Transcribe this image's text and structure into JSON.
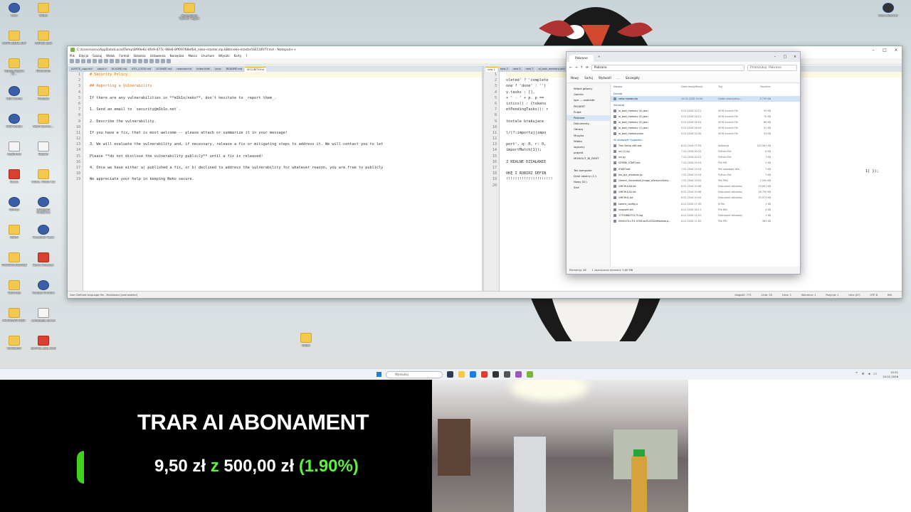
{
  "desktop": {
    "icons_left": [
      {
        "label": "Kosz",
        "kind": "app"
      },
      {
        "label": "MATH_QUIZ_APP",
        "kind": "folder"
      },
      {
        "label": "Attack Report M…",
        "kind": "folder"
      },
      {
        "label": "OBS Studio",
        "kind": "app"
      },
      {
        "label": "OBS-Studio",
        "kind": "app"
      },
      {
        "label": "Ag-BJ-tyle",
        "kind": "doc"
      },
      {
        "label": "Brave",
        "kind": "red"
      },
      {
        "label": "Obrazy",
        "kind": "app"
      },
      {
        "label": "QSUN",
        "kind": "folder"
      },
      {
        "label": "PROGRAMOWANIE",
        "kind": "folder"
      },
      {
        "label": "Edit-tryg",
        "kind": "folder"
      },
      {
        "label": "PR-PRAWO-ROZ-",
        "kind": "folder"
      },
      {
        "label": "Kalkulator",
        "kind": "folder"
      }
    ],
    "icons_col2": [
      {
        "label": "Kluby",
        "kind": "folder"
      },
      {
        "label": "MATHE_UJ-S",
        "kind": "folder"
      },
      {
        "label": "Ekonomia",
        "kind": "folder"
      },
      {
        "label": "Podcast",
        "kind": "folder"
      },
      {
        "label": "Neon-Ks-Acc…",
        "kind": "folder"
      },
      {
        "label": "Bigtwo",
        "kind": "doc"
      },
      {
        "label": "Klony, Folder (2)",
        "kind": "folder"
      },
      {
        "label": "Microsoft OneDrive",
        "kind": "app"
      },
      {
        "label": "Facebook Teaw",
        "kind": "app"
      },
      {
        "label": "Brave Browser",
        "kind": "red"
      },
      {
        "label": "Google Chrome",
        "kind": "app"
      },
      {
        "label": "Language_de-en",
        "kind": "doc"
      },
      {
        "label": "gaming_app_cloud",
        "kind": "red"
      }
    ],
    "top_icon": {
      "label": "Screenshot Upload Toggle"
    },
    "mid_folder": {
      "label": "folder"
    },
    "recycle_right": {
      "label": "Kosz aktywny"
    }
  },
  "notepad": {
    "title": "C:\\Users\\ozsu\\AppData\\Local\\Temp\\8f99e6c-4fe9-477c-98e6-8ff09768efb4_neko-master.zip.b8b\\neko-master\\SECURITY.md - Notepad++",
    "menu": [
      "Plik",
      "Edycja",
      "Szukaj",
      "Widok",
      "Format",
      "Składnia",
      "Ustawienia",
      "Narzędzia",
      "Makra",
      "Uruchom",
      "Wtyczki",
      "Karty",
      "?"
    ],
    "left_tabs": [
      "ALYSTE_copy.md",
      "stack.h",
      "ACLONE.md",
      "KTO_LOGGI.md",
      "LICENSE.md",
      "readme.md",
      "index.html",
      "ionic",
      "README.md",
      "SECURITY.md"
    ],
    "right_tabs": [
      "new 1",
      "new 3",
      "new 5",
      "new 7",
      "ai_task_memory.json"
    ],
    "left_lines": [
      "# Security Policy",
      "",
      "## Reporting a Vulnerability",
      "",
      "If there are any vulnerabilities in **m1k1o/neko**, don't hesitate to _report them_.",
      "",
      "1. Send an email to `security@m1k1o.net`.",
      "",
      "2. Describe the vulnerability.",
      "",
      "   If you have a fix, that is most welcome -- please attach or summarize it in your message!",
      "",
      "3. We will evaluate the vulnerability and, if necessary, release a fix or mitigating steps to address it. We will contact you to let",
      "",
      "   Please **do not disclose the vulnerability publicly** until a fix is released!",
      "",
      "4. Once we have either a) published a fix, or b) declined to address the vulnerability for whatever reason, you are free to publicly",
      "",
      "We appreciate your help in keeping Neko secure."
    ],
    "right_lines": [
      "",
      "oleted' ? 'complete",
      "one ? 'done' : '')",
      "y.tasks : [],",
      "+ ' - ' + p. p ==",
      "istics() : {tokens",
      "etPendingTasks(): r",
      "",
      "tostale brakujace",
      "",
      "l/(?:importuj|impo",
      "",
      "port', q: 0, r: 0,",
      "  importMatch[1]);",
      "",
      "Z REALNE DZIAŁANIE",
      "",
      "UKĘ I ROBIRZ DEFIN",
      "!!!!!!!!!!!!!!!!!!!!!",
      ""
    ],
    "right_extra": "1] });",
    "status": {
      "language": "User Defined language file - Markdown (preinstalled)",
      "length": "długość: 773",
      "lines": "Linie: 20",
      "ln": "Linia: 1",
      "col": "Kolumna: 1",
      "pos": "Pozycja: 1",
      "eol": "Unix (LF)",
      "enc": "UTF-8",
      "ins": "INS"
    }
  },
  "explorer": {
    "tab": "Pobrane",
    "path": "Pobrane",
    "search_placeholder": "Przeszukaj: Pobrane",
    "toolbar": [
      "Nowy",
      "Sortuj",
      "Wyświetl",
      "…",
      "Szczegóły"
    ],
    "nav": [
      "Widok główny",
      "Galeria",
      "Igor — osobiste",
      "PROJEKT",
      "Pulpit",
      "Pobrane",
      "Dokumenty",
      "Obrazy",
      "Muzyka",
      "Wideo",
      "logiczny",
      "projekt",
      "MONOLIT_BI_RENT",
      "",
      "Ten komputer",
      "Dysk lokalny (C:)",
      "Nowy (D:)",
      "Sieć"
    ],
    "headers": [
      "Nazwa",
      "Data modyfikacji",
      "Typ",
      "Rozmiar"
    ],
    "rows": [
      {
        "group": "Dzisiaj"
      },
      {
        "name": "neko-master.zip",
        "date": "10.02.2026 10:04",
        "type": "Folder skompreso…",
        "size": "5 735 KB",
        "selected": true
      },
      {
        "group": "Wczoraj"
      },
      {
        "name": "ai_task_memory (4).json",
        "date": "9.02.2026 20:21",
        "type": "JSON Source File",
        "size": "55 KB"
      },
      {
        "name": "ai_task_memory (2).json",
        "date": "9.02.2026 18:21",
        "type": "JSON Source File",
        "size": "70 KB"
      },
      {
        "name": "ai_task_memory (2).json",
        "date": "9.02.2026 16:20",
        "type": "JSON Source File",
        "size": "66 KB"
      },
      {
        "name": "ai_task_memory (1).json",
        "date": "9.02.2026 16:09",
        "type": "JSON Source File",
        "size": "51 KB"
      },
      {
        "name": "ai_task_memory.json",
        "date": "9.02.2026 15:40",
        "type": "JSON Source File",
        "size": "53 KB"
      },
      {
        "group": "W ubiegłym tygodniu"
      },
      {
        "name": "Tran Setup x64.exe",
        "date": "8.02.2026 07:55",
        "type": "Aplikacja",
        "size": "120 061 KB"
      },
      {
        "name": "scr (1).py",
        "date": "7.02.2026 20:33",
        "type": "Python File",
        "size": "6 KB"
      },
      {
        "name": "scr.py",
        "date": "7.02.2026 20:23",
        "type": "Python File",
        "size": "7 KB"
      },
      {
        "name": "SZYBKI_START.md",
        "date": "7.02.2026 19:19",
        "type": "Plik MD",
        "size": "2 KB"
      },
      {
        "name": "START.bat",
        "date": "7.02.2026 19:18",
        "type": "Plik wsadowy Win…",
        "size": "7 KB"
      },
      {
        "name": "tex_gui_windows.py",
        "date": "7.02.2026 19:16",
        "type": "Python File",
        "size": "7 KB"
      },
      {
        "name": "Gemini_Generated_Image_s5kmycv5kmy…",
        "date": "7.02.2026 13:55",
        "type": "Plik PNG",
        "size": "2 540 KB"
      },
      {
        "name": "UMCHUL04.txt",
        "date": "6.02.2026 20:06",
        "type": "Dokument tekstowy",
        "size": "29 601 KB"
      },
      {
        "name": "UMCHUL02.txt",
        "date": "6.02.2026 20:06",
        "type": "Dokument tekstowy",
        "size": "16 750 KB"
      },
      {
        "name": "UMCHUL.txt",
        "date": "6.02.2026 20:04",
        "type": "Dokument tekstowy",
        "size": "33 973 KB"
      },
      {
        "name": "tokens_config.js",
        "date": "6.02.2026 17:39",
        "type": "JS file",
        "size": "1 KB"
      },
      {
        "name": "snapsert.bin",
        "date": "6.02.2026 16:11",
        "type": "Plik BIN",
        "size": "4 KB"
      },
      {
        "name": "1770388275175.log",
        "date": "6.02.2026 15:01",
        "type": "Dokument tekstowy",
        "size": "1 KB"
      },
      {
        "name": "09e5070-c7f1-4708-bcf3-0002effadeda.p…",
        "date": "6.02.2026 11:00",
        "type": "Plik IPD",
        "size": "365 KB"
      }
    ],
    "status": {
      "count": "Elementy: 36",
      "selected": "1 zaznaczony element: 5,60 MB"
    }
  },
  "taskbar": {
    "search_placeholder": "Wyszukaj",
    "time": "10:31",
    "date": "10.02.2026"
  },
  "overlay": {
    "title": "TRAR AI ABONAMENT",
    "current": "9,50 zł",
    "of_word": "z",
    "goal": "500,00 zł",
    "percent": "(1.90%)",
    "progress_fraction": 0.019,
    "accent": "#5ef03d"
  }
}
